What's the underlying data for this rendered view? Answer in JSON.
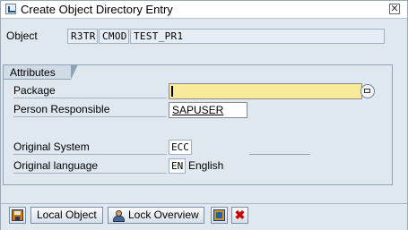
{
  "window": {
    "title": "Create Object Directory Entry"
  },
  "object": {
    "label": "Object",
    "pgmid": "R3TR",
    "type": "CMOD",
    "name": "TEST_PR1"
  },
  "attributes": {
    "group_title": "Attributes",
    "package": {
      "label": "Package",
      "value": ""
    },
    "person_responsible": {
      "label": "Person Responsible",
      "value": "SAPUSER"
    },
    "original_system": {
      "label": "Original System",
      "value": "ECC"
    },
    "original_language": {
      "label": "Original language",
      "code": "EN",
      "text": "English"
    }
  },
  "toolbar": {
    "local_object_label": "Local Object",
    "lock_overview_label": "Lock Overview"
  },
  "icons": {
    "save": "save-icon",
    "lock_overview": "person-icon",
    "check": "check-icon",
    "cancel": "close-x-icon"
  },
  "colors": {
    "required_field": "#f9e99a",
    "cancel_red": "#cc0000"
  }
}
